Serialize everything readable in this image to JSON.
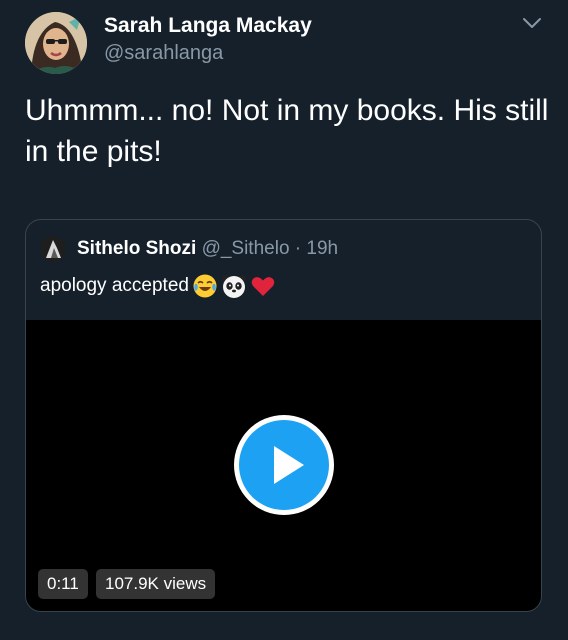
{
  "author": {
    "name": "Sarah Langa Mackay",
    "handle": "@sarahlanga"
  },
  "tweet": {
    "text": "Uhmmm... no! Not in my books. His still in the pits!"
  },
  "quoted": {
    "name": "Sithelo Shozi",
    "handle": "@_Sithelo",
    "separator": "·",
    "time": "19h",
    "text": "apology accepted",
    "emojis": [
      "face-with-tears-of-joy",
      "panda-face",
      "red-heart"
    ],
    "video": {
      "duration": "0:11",
      "views": "107.9K views"
    }
  },
  "colors": {
    "background": "#15202b",
    "secondary_text": "#8899a6",
    "border": "#38444d",
    "play_accent": "#1da1f2"
  }
}
